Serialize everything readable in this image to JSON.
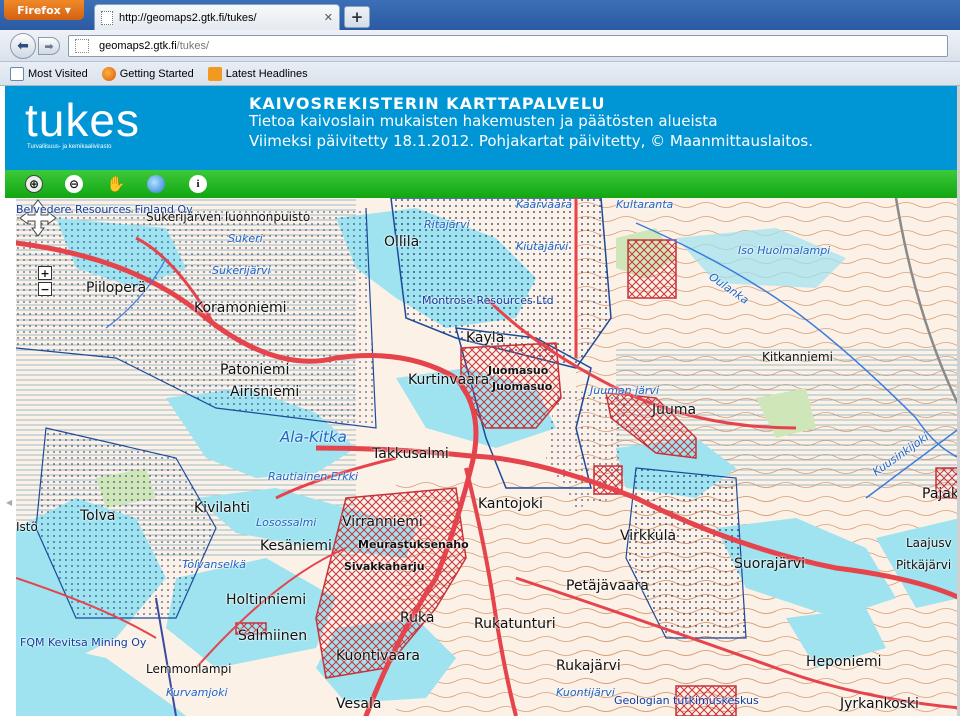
{
  "browser": {
    "menu_label": "Firefox",
    "tab_title": "http://geomaps2.gtk.fi/tukes/",
    "tab_close": "✕",
    "new_tab": "+",
    "url_domain": "geomaps2.gtk.fi",
    "url_path": "/tukes/",
    "bookmarks": [
      "Most Visited",
      "Getting Started",
      "Latest Headlines"
    ]
  },
  "header": {
    "logo_text": "tukes",
    "logo_sub": "Turvallisuus- ja kemikaalivirasto",
    "title": "KAIVOSREKISTERIN KARTTAPALVELU",
    "line1": "Tietoa kaivoslain mukaisten hakemusten ja päätösten alueista",
    "line2": "Viimeksi päivitetty 18.1.2012. Pohjakartat päivitetty, © Maanmittauslaitos."
  },
  "toolbar": {
    "tools": [
      "zoom-in",
      "zoom-out",
      "pan",
      "full-extent",
      "info"
    ]
  },
  "map": {
    "controls": {
      "zoom_in": "+",
      "zoom_out": "−"
    },
    "places": [
      "Sukerijärven luonnonpuisto",
      "Ollila",
      "Piiloperä",
      "Koramoniemi",
      "Patoniemi",
      "Airisniemi",
      "Kurtinvaara",
      "Kayla",
      "Juuma",
      "Takkusalmi",
      "Kantojoki",
      "Tolva",
      "Kivilahti",
      "Kesäniemi",
      "Virranniemi",
      "Virkkula",
      "Suorajärvi",
      "Petäjävaara",
      "Holtinniemi",
      "Rukatunturi",
      "Ruka",
      "Kuontivaara",
      "Salmiinen",
      "Rukajärvi",
      "Heponiemi",
      "Jyrkankoski",
      "Vesala",
      "Lemmonlampi",
      "Kitkanniemi",
      "Istö",
      "Pajak",
      "Laajusv",
      "Pitkäjärvi"
    ],
    "waters": [
      "Sukeri",
      "Sukerijärvi",
      "Iso Huolmalampi",
      "Oulanka",
      "Ala-Kitka",
      "Rautiainen Erkki",
      "Losossalmi",
      "Tolvanselkä",
      "Kuontijärvi",
      "Kurvamjoki",
      "Kiutajärvi",
      "Juuman järvi",
      "Kuusinkijoki",
      "Ritajärvi",
      "Kaarvaara",
      "Kultaranta"
    ],
    "companies": [
      "Belvedere Resources Finland Oy",
      "Montrose Resources Ltd",
      "FQM Kevitsa Mining Oy",
      "Geologian tutkimuskeskus"
    ],
    "reservations": [
      "Juomasuo",
      "Juomasuo",
      "Meurastuksenaho",
      "Sivakkaharju"
    ]
  }
}
